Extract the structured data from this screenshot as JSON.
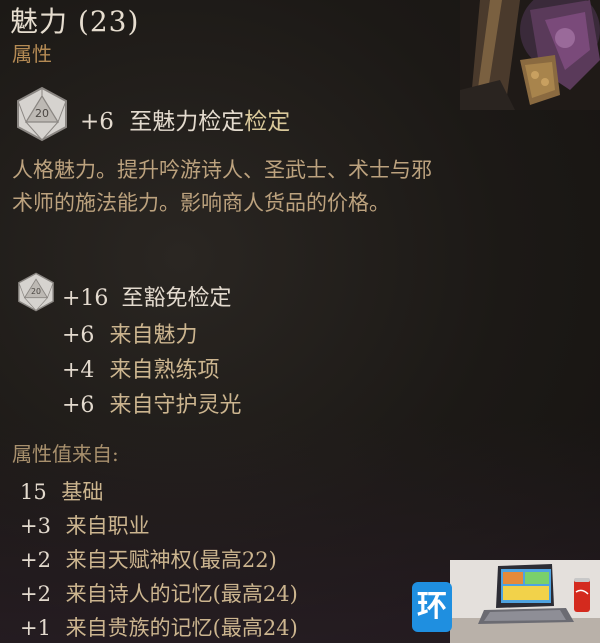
{
  "tooltip": {
    "title": "魅力 (23)",
    "subtitle": "属性",
    "ability_check": {
      "bonus": "+6",
      "text": "至魅力检定",
      "highlight": "检定",
      "die_label": "20"
    },
    "description": "人格魅力。提升吟游诗人、圣武士、术士与邪术师的施法能力。影响商人货品的价格。",
    "saving_throw": {
      "bonus": "+16",
      "text": "至豁免检定",
      "die_label": "20",
      "breakdown": [
        {
          "value": "+6",
          "source": "来自魅力"
        },
        {
          "value": "+4",
          "source": "来自熟练项"
        },
        {
          "value": "+6",
          "source": "来自守护灵光"
        }
      ]
    },
    "value_from_label": "属性值来自:",
    "value_sources": [
      {
        "value": "15",
        "source": "基础"
      },
      {
        "value": "+3",
        "source": "来自职业"
      },
      {
        "value": "+2",
        "source": "来自天赋神权(最高22)"
      },
      {
        "value": "+2",
        "source": "来自诗人的记忆(最高24)"
      },
      {
        "value": "+1",
        "source": "来自贵族的记忆(最高24)"
      }
    ]
  },
  "watermark": {
    "logo_char": "环"
  },
  "icons": {
    "check_die": "d20-die-icon",
    "save_die": "d20-die-icon",
    "portrait": "character-portrait",
    "watermark_logo": "site-logo-icon"
  },
  "colors": {
    "title": "#e6ddcf",
    "subtitle": "#b48a54",
    "description": "#bca27e",
    "bonus_text": "#ccb58f",
    "background": "#1d1a17",
    "watermark_logo": "#1f8fe0"
  }
}
